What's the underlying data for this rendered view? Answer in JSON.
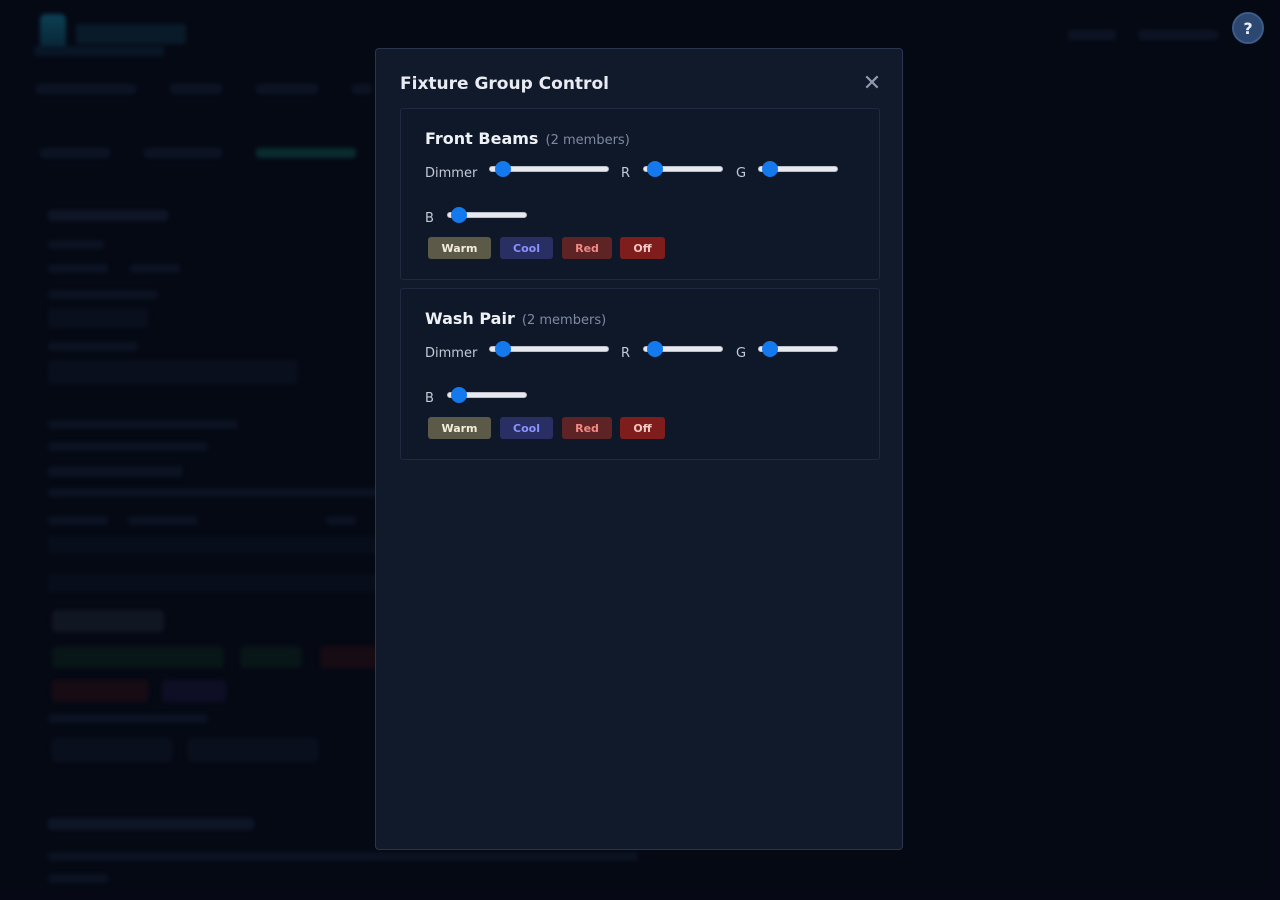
{
  "modal": {
    "title": "Fixture Group Control",
    "close_icon": "close-icon",
    "groups": [
      {
        "name": "Front Beams",
        "members": "(2 members)",
        "controls": [
          {
            "label": "Dimmer",
            "value": 0.05
          },
          {
            "label": "R",
            "value": 0.05
          },
          {
            "label": "G",
            "value": 0.05
          },
          {
            "label": "B",
            "value": 0.05
          }
        ],
        "presets": [
          {
            "label": "Warm",
            "bg": "#5b5a48",
            "fg": "#f2eedb"
          },
          {
            "label": "Cool",
            "bg": "#2a2f63",
            "fg": "#8a92ff"
          },
          {
            "label": "Red",
            "bg": "#5e2324",
            "fg": "#f08a84"
          },
          {
            "label": "Off",
            "bg": "#7f1c1c",
            "fg": "#f3c9c5"
          }
        ]
      },
      {
        "name": "Wash Pair",
        "members": "(2 members)",
        "controls": [
          {
            "label": "Dimmer",
            "value": 0.05
          },
          {
            "label": "R",
            "value": 0.05
          },
          {
            "label": "G",
            "value": 0.05
          },
          {
            "label": "B",
            "value": 0.05
          }
        ],
        "presets": [
          {
            "label": "Warm",
            "bg": "#5b5a48",
            "fg": "#f2eedb"
          },
          {
            "label": "Cool",
            "bg": "#2a2f63",
            "fg": "#8a92ff"
          },
          {
            "label": "Red",
            "bg": "#5e2324",
            "fg": "#f08a84"
          },
          {
            "label": "Off",
            "bg": "#7f1c1c",
            "fg": "#f3c9c5"
          }
        ]
      }
    ]
  },
  "help": {
    "label": "?"
  },
  "colors": {
    "accent": "#1479ec",
    "background": "#070b18",
    "modal_bg": "#111a2b"
  }
}
